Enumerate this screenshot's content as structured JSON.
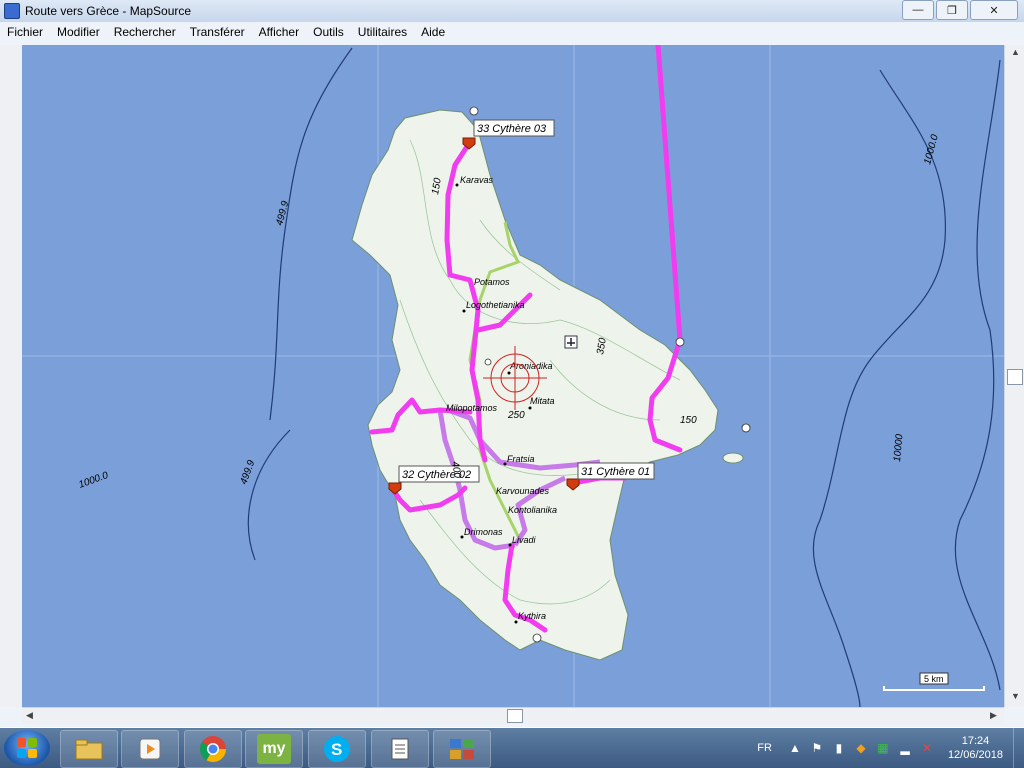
{
  "window": {
    "title": "Route vers Grèce - MapSource",
    "minimize_glyph": "—",
    "maximize_glyph": "❐",
    "close_glyph": "✕"
  },
  "menu": {
    "items": [
      "Fichier",
      "Modifier",
      "Rechercher",
      "Transférer",
      "Afficher",
      "Outils",
      "Utilitaires",
      "Aide"
    ]
  },
  "map": {
    "waypoints": {
      "w31": "31 Cythère 01",
      "w32": "32 Cythère 02",
      "w33": "33 Cythère 03"
    },
    "places": {
      "karavas": "Karavas",
      "potamos": "Potamos",
      "logothetianika": "Logothetianika",
      "aroniadika": "Aroniadika",
      "mitata": "Mitata",
      "milopotamos": "Milopotamos",
      "fratsia": "Fratsia",
      "karvounades": "Karvounades",
      "kontolianika": "Kontolianika",
      "dokana": "Drimonas",
      "livadi": "Livadi",
      "kythira": "Kythira"
    },
    "depths": {
      "d1": "499.9",
      "d2": "1000.0",
      "d3": "499.9",
      "d4": "1000.0",
      "d5": "10000"
    },
    "elevations": {
      "e150a": "150",
      "e350": "350",
      "e250": "250",
      "e150b": "150",
      "e400": "400"
    },
    "scale": "5 km",
    "colors": {
      "sea": "#7b9fd9",
      "land": "#eef4ec",
      "route_primary": "#f23cf0",
      "route_secondary": "#c77be8"
    }
  },
  "taskbar": {
    "language": "FR",
    "time": "17:24",
    "date": "12/06/2018",
    "apps": [
      "folder-icon",
      "media-player-icon",
      "chrome-icon",
      "my-app-icon",
      "skype-icon",
      "notes-icon",
      "control-panel-icon"
    ],
    "my_label": "my"
  }
}
